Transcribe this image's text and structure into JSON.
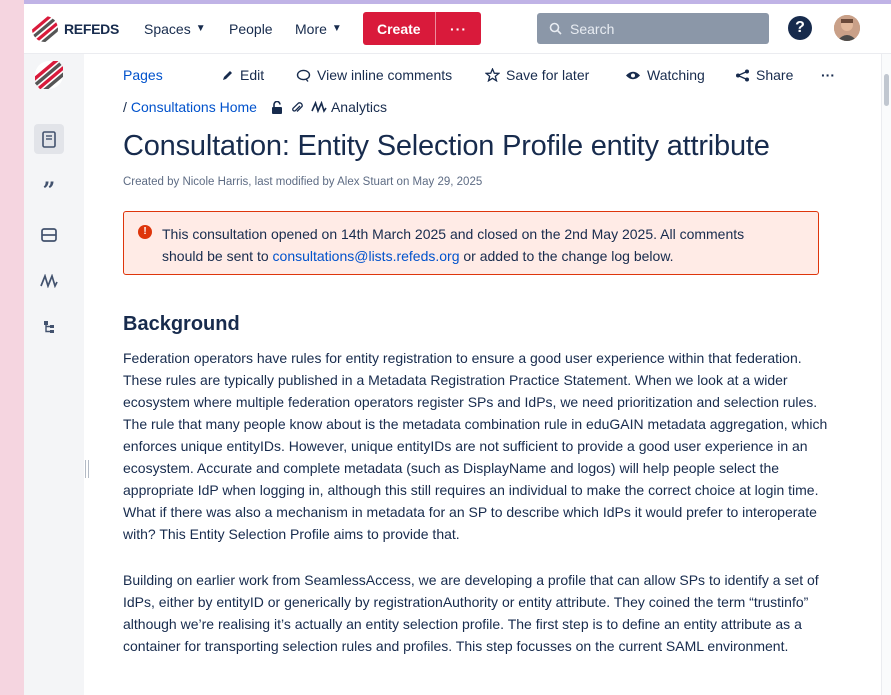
{
  "app": {
    "brand": "REFEDS",
    "colors": {
      "accent": "#d91a3b",
      "link": "#0052cc",
      "text": "#172b4d",
      "notice_border": "#de350b",
      "notice_bg": "#ffebe6"
    }
  },
  "topnav": {
    "spaces": "Spaces",
    "people": "People",
    "more": "More",
    "create": "Create",
    "create_more": "···",
    "search_placeholder": "Search",
    "help": "?"
  },
  "rail": {
    "items": [
      "pages-icon",
      "quote-icon",
      "calendar-icon",
      "analytics-icon",
      "hierarchy-icon"
    ]
  },
  "actions": {
    "pages": "Pages",
    "edit": "Edit",
    "view_comments": "View inline comments",
    "save_later": "Save for later",
    "watching": "Watching",
    "share": "Share",
    "more": "···"
  },
  "breadcrumb": {
    "separator": "/",
    "parent": "Consultations Home",
    "analytics": "Analytics"
  },
  "page": {
    "title": "Consultation: Entity Selection Profile entity attribute",
    "byline": "Created by Nicole Harris, last modified by Alex Stuart on May 29, 2025",
    "notice_line1": "This consultation opened on 14th March 2025 and closed on the 2nd May 2025.  All comments",
    "notice_pre": "should be sent to ",
    "notice_email": "consultations@lists.refeds.org",
    "notice_post": " or added to the change log below.",
    "heading_background": "Background",
    "paragraph1": "Federation operators have rules for entity registration to ensure a good user experience within that federation. These rules are typically published in a Metadata Registration Practice Statement. When we look at a wider ecosystem where multiple federation operators register SPs and IdPs, we need prioritization and selection rules. The rule that many people know about is the metadata combination rule in eduGAIN metadata aggregation, which enforces unique entityIDs. However, unique entityIDs are not sufficient to provide a good user experience in an ecosystem. Accurate and complete metadata (such as DisplayName and logos) will help people select the appropriate IdP when logging in, although this still requires an individual to make the correct choice at login time. What if there was also a mechanism in metadata for an SP to describe which IdPs it would prefer to interoperate with? This Entity Selection Profile aims to provide that.",
    "paragraph2": "Building on earlier work from SeamlessAccess, we are developing a profile that can allow SPs to identify a set of IdPs, either by entityID or generically by registrationAuthority or entity attribute. They coined the term “trustinfo” although we’re realising it’s actually an entity selection profile. The first step is to define an entity attribute as a container for transporting selection rules and profiles. This step focusses on the current SAML environment."
  }
}
